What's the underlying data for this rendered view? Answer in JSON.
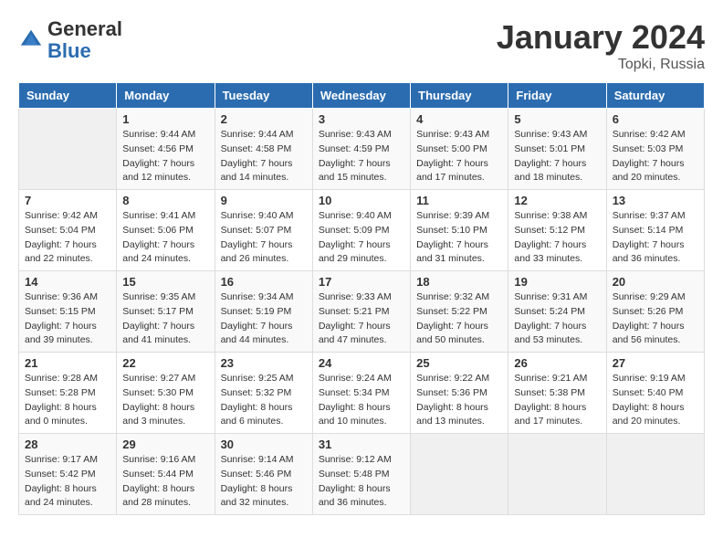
{
  "header": {
    "logo_general": "General",
    "logo_blue": "Blue",
    "month_year": "January 2024",
    "location": "Topki, Russia"
  },
  "days_of_week": [
    "Sunday",
    "Monday",
    "Tuesday",
    "Wednesday",
    "Thursday",
    "Friday",
    "Saturday"
  ],
  "weeks": [
    [
      {
        "day": "",
        "sunrise": "",
        "sunset": "",
        "daylight": ""
      },
      {
        "day": "1",
        "sunrise": "Sunrise: 9:44 AM",
        "sunset": "Sunset: 4:56 PM",
        "daylight": "Daylight: 7 hours and 12 minutes."
      },
      {
        "day": "2",
        "sunrise": "Sunrise: 9:44 AM",
        "sunset": "Sunset: 4:58 PM",
        "daylight": "Daylight: 7 hours and 14 minutes."
      },
      {
        "day": "3",
        "sunrise": "Sunrise: 9:43 AM",
        "sunset": "Sunset: 4:59 PM",
        "daylight": "Daylight: 7 hours and 15 minutes."
      },
      {
        "day": "4",
        "sunrise": "Sunrise: 9:43 AM",
        "sunset": "Sunset: 5:00 PM",
        "daylight": "Daylight: 7 hours and 17 minutes."
      },
      {
        "day": "5",
        "sunrise": "Sunrise: 9:43 AM",
        "sunset": "Sunset: 5:01 PM",
        "daylight": "Daylight: 7 hours and 18 minutes."
      },
      {
        "day": "6",
        "sunrise": "Sunrise: 9:42 AM",
        "sunset": "Sunset: 5:03 PM",
        "daylight": "Daylight: 7 hours and 20 minutes."
      }
    ],
    [
      {
        "day": "7",
        "sunrise": "Sunrise: 9:42 AM",
        "sunset": "Sunset: 5:04 PM",
        "daylight": "Daylight: 7 hours and 22 minutes."
      },
      {
        "day": "8",
        "sunrise": "Sunrise: 9:41 AM",
        "sunset": "Sunset: 5:06 PM",
        "daylight": "Daylight: 7 hours and 24 minutes."
      },
      {
        "day": "9",
        "sunrise": "Sunrise: 9:40 AM",
        "sunset": "Sunset: 5:07 PM",
        "daylight": "Daylight: 7 hours and 26 minutes."
      },
      {
        "day": "10",
        "sunrise": "Sunrise: 9:40 AM",
        "sunset": "Sunset: 5:09 PM",
        "daylight": "Daylight: 7 hours and 29 minutes."
      },
      {
        "day": "11",
        "sunrise": "Sunrise: 9:39 AM",
        "sunset": "Sunset: 5:10 PM",
        "daylight": "Daylight: 7 hours and 31 minutes."
      },
      {
        "day": "12",
        "sunrise": "Sunrise: 9:38 AM",
        "sunset": "Sunset: 5:12 PM",
        "daylight": "Daylight: 7 hours and 33 minutes."
      },
      {
        "day": "13",
        "sunrise": "Sunrise: 9:37 AM",
        "sunset": "Sunset: 5:14 PM",
        "daylight": "Daylight: 7 hours and 36 minutes."
      }
    ],
    [
      {
        "day": "14",
        "sunrise": "Sunrise: 9:36 AM",
        "sunset": "Sunset: 5:15 PM",
        "daylight": "Daylight: 7 hours and 39 minutes."
      },
      {
        "day": "15",
        "sunrise": "Sunrise: 9:35 AM",
        "sunset": "Sunset: 5:17 PM",
        "daylight": "Daylight: 7 hours and 41 minutes."
      },
      {
        "day": "16",
        "sunrise": "Sunrise: 9:34 AM",
        "sunset": "Sunset: 5:19 PM",
        "daylight": "Daylight: 7 hours and 44 minutes."
      },
      {
        "day": "17",
        "sunrise": "Sunrise: 9:33 AM",
        "sunset": "Sunset: 5:21 PM",
        "daylight": "Daylight: 7 hours and 47 minutes."
      },
      {
        "day": "18",
        "sunrise": "Sunrise: 9:32 AM",
        "sunset": "Sunset: 5:22 PM",
        "daylight": "Daylight: 7 hours and 50 minutes."
      },
      {
        "day": "19",
        "sunrise": "Sunrise: 9:31 AM",
        "sunset": "Sunset: 5:24 PM",
        "daylight": "Daylight: 7 hours and 53 minutes."
      },
      {
        "day": "20",
        "sunrise": "Sunrise: 9:29 AM",
        "sunset": "Sunset: 5:26 PM",
        "daylight": "Daylight: 7 hours and 56 minutes."
      }
    ],
    [
      {
        "day": "21",
        "sunrise": "Sunrise: 9:28 AM",
        "sunset": "Sunset: 5:28 PM",
        "daylight": "Daylight: 8 hours and 0 minutes."
      },
      {
        "day": "22",
        "sunrise": "Sunrise: 9:27 AM",
        "sunset": "Sunset: 5:30 PM",
        "daylight": "Daylight: 8 hours and 3 minutes."
      },
      {
        "day": "23",
        "sunrise": "Sunrise: 9:25 AM",
        "sunset": "Sunset: 5:32 PM",
        "daylight": "Daylight: 8 hours and 6 minutes."
      },
      {
        "day": "24",
        "sunrise": "Sunrise: 9:24 AM",
        "sunset": "Sunset: 5:34 PM",
        "daylight": "Daylight: 8 hours and 10 minutes."
      },
      {
        "day": "25",
        "sunrise": "Sunrise: 9:22 AM",
        "sunset": "Sunset: 5:36 PM",
        "daylight": "Daylight: 8 hours and 13 minutes."
      },
      {
        "day": "26",
        "sunrise": "Sunrise: 9:21 AM",
        "sunset": "Sunset: 5:38 PM",
        "daylight": "Daylight: 8 hours and 17 minutes."
      },
      {
        "day": "27",
        "sunrise": "Sunrise: 9:19 AM",
        "sunset": "Sunset: 5:40 PM",
        "daylight": "Daylight: 8 hours and 20 minutes."
      }
    ],
    [
      {
        "day": "28",
        "sunrise": "Sunrise: 9:17 AM",
        "sunset": "Sunset: 5:42 PM",
        "daylight": "Daylight: 8 hours and 24 minutes."
      },
      {
        "day": "29",
        "sunrise": "Sunrise: 9:16 AM",
        "sunset": "Sunset: 5:44 PM",
        "daylight": "Daylight: 8 hours and 28 minutes."
      },
      {
        "day": "30",
        "sunrise": "Sunrise: 9:14 AM",
        "sunset": "Sunset: 5:46 PM",
        "daylight": "Daylight: 8 hours and 32 minutes."
      },
      {
        "day": "31",
        "sunrise": "Sunrise: 9:12 AM",
        "sunset": "Sunset: 5:48 PM",
        "daylight": "Daylight: 8 hours and 36 minutes."
      },
      {
        "day": "",
        "sunrise": "",
        "sunset": "",
        "daylight": ""
      },
      {
        "day": "",
        "sunrise": "",
        "sunset": "",
        "daylight": ""
      },
      {
        "day": "",
        "sunrise": "",
        "sunset": "",
        "daylight": ""
      }
    ]
  ]
}
